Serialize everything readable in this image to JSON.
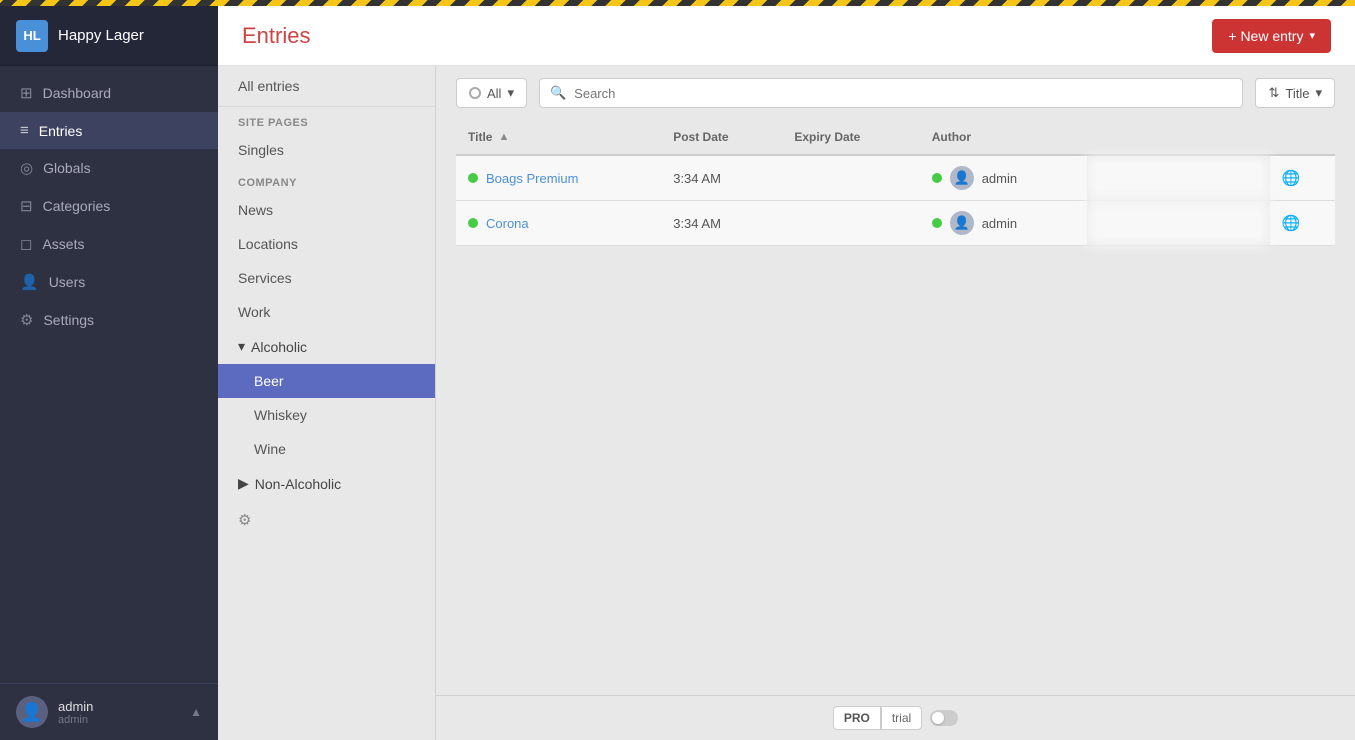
{
  "app": {
    "brand": "Happy Lager",
    "logo": "HL",
    "top_stripe": true
  },
  "sidebar": {
    "nav_items": [
      {
        "id": "dashboard",
        "label": "Dashboard",
        "icon": "⊞",
        "active": false
      },
      {
        "id": "entries",
        "label": "Entries",
        "icon": "≡",
        "active": true
      },
      {
        "id": "globals",
        "label": "Globals",
        "icon": "◎",
        "active": false
      },
      {
        "id": "categories",
        "label": "Categories",
        "icon": "⊟",
        "active": false
      },
      {
        "id": "assets",
        "label": "Assets",
        "icon": "◻",
        "active": false
      },
      {
        "id": "users",
        "label": "Users",
        "icon": "👤",
        "active": false
      },
      {
        "id": "settings",
        "label": "Settings",
        "icon": "⚙",
        "active": false
      }
    ],
    "footer": {
      "username": "admin",
      "role": "admin"
    }
  },
  "header": {
    "title": "Entries",
    "new_entry_button": "+ New entry"
  },
  "left_panel": {
    "all_entries_label": "All entries",
    "sections": [
      {
        "label": "SITE PAGES",
        "items": [
          {
            "id": "singles",
            "label": "Singles"
          }
        ]
      },
      {
        "label": "COMPANY",
        "items": [
          {
            "id": "news",
            "label": "News"
          },
          {
            "id": "locations",
            "label": "Locations"
          },
          {
            "id": "services",
            "label": "Services"
          },
          {
            "id": "work",
            "label": "Work"
          }
        ]
      }
    ],
    "groups": [
      {
        "id": "alcoholic",
        "label": "Alcoholic",
        "expanded": true,
        "children": [
          {
            "id": "beer",
            "label": "Beer",
            "active": true
          },
          {
            "id": "whiskey",
            "label": "Whiskey",
            "active": false
          },
          {
            "id": "wine",
            "label": "Wine",
            "active": false
          }
        ]
      },
      {
        "id": "non-alcoholic",
        "label": "Non-Alcoholic",
        "expanded": false,
        "children": []
      }
    ],
    "gear_label": "⚙"
  },
  "filter_bar": {
    "all_label": "All",
    "search_placeholder": "Search",
    "title_sort_label": "Title"
  },
  "table": {
    "columns": [
      {
        "id": "title",
        "label": "Title",
        "sortable": true
      },
      {
        "id": "post_date",
        "label": "Post Date"
      },
      {
        "id": "expiry_date",
        "label": "Expiry Date"
      },
      {
        "id": "author",
        "label": "Author"
      },
      {
        "id": "blurred",
        "label": ""
      },
      {
        "id": "globe",
        "label": ""
      }
    ],
    "rows": [
      {
        "id": 1,
        "status": "live",
        "title": "Boags Premium",
        "post_date": "3:34 AM",
        "expiry_date": "",
        "author_status": "live",
        "author": "admin",
        "globe": true
      },
      {
        "id": 2,
        "status": "live",
        "title": "Corona",
        "post_date": "3:34 AM",
        "expiry_date": "",
        "author_status": "live",
        "author": "admin",
        "globe": true
      }
    ]
  },
  "bottom_bar": {
    "pro_label": "PRO",
    "trial_label": "trial"
  }
}
